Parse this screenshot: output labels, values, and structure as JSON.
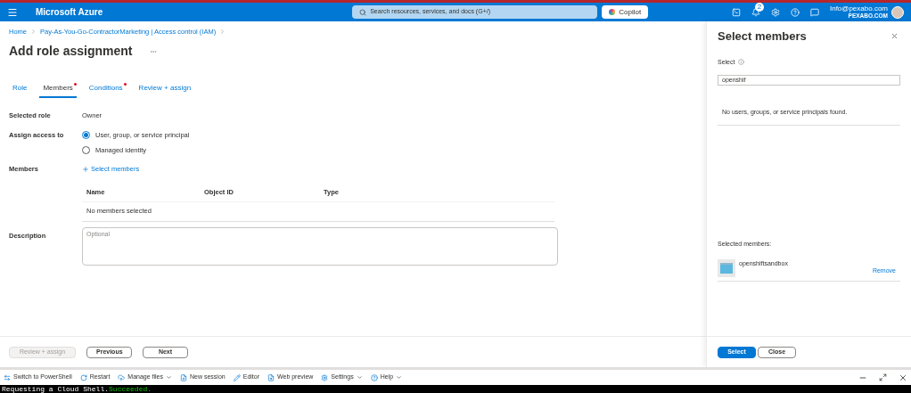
{
  "header": {
    "brand": "Microsoft Azure",
    "search": {
      "placeholder": "Search resources, services, and docs (G+/)"
    },
    "copilot": "Copilot",
    "notifications": "2",
    "account": {
      "email": "Info@pexabo.com",
      "tenant": "PEXABO.COM"
    }
  },
  "breadcrumb": [
    "Home",
    "Pay-As-You-Go-ContractorMarketing | Access control (IAM)"
  ],
  "page": {
    "title": "Add role assignment"
  },
  "tabs": [
    {
      "label": "Role",
      "selected": false,
      "required": false
    },
    {
      "label": "Members",
      "selected": true,
      "required": true
    },
    {
      "label": "Conditions",
      "selected": false,
      "required": true
    },
    {
      "label": "Review + assign",
      "selected": false,
      "required": false
    }
  ],
  "selected_role": {
    "label": "Selected role",
    "value": "Owner"
  },
  "assign_access": {
    "label": "Assign access to",
    "options": [
      {
        "label": "User, group, or service principal",
        "selected": true
      },
      {
        "label": "Managed identity",
        "selected": false
      }
    ]
  },
  "members": {
    "label": "Members",
    "add_link": "Select members",
    "table": {
      "columns": [
        "Name",
        "Object ID",
        "Type"
      ],
      "empty": "No members selected"
    }
  },
  "description": {
    "label": "Description",
    "placeholder": "Optional"
  },
  "footer_buttons": [
    {
      "label": "Review + assign",
      "disabled": true
    },
    {
      "label": "Previous",
      "disabled": false
    },
    {
      "label": "Next",
      "disabled": false
    }
  ],
  "panel": {
    "title": "Select members",
    "select_label": "Select",
    "search_value": "openshif",
    "empty_message": "No users, groups, or service principals found.",
    "selected_heading": "Selected members:",
    "selected": [
      {
        "name": "openshiftsandbox",
        "action": "Remove"
      }
    ],
    "buttons": [
      {
        "label": "Select",
        "primary": true
      },
      {
        "label": "Close",
        "primary": false
      }
    ]
  },
  "shell": {
    "toolbar": [
      {
        "label": "Switch to PowerShell",
        "dropdown": false
      },
      {
        "label": "Restart",
        "dropdown": false
      },
      {
        "label": "Manage files",
        "dropdown": true
      },
      {
        "label": "New session",
        "dropdown": false
      },
      {
        "label": "Editor",
        "dropdown": false
      },
      {
        "label": "Web preview",
        "dropdown": false
      },
      {
        "label": "Settings",
        "dropdown": true
      },
      {
        "label": "Help",
        "dropdown": true
      }
    ],
    "terminal": [
      {
        "text": "Requesting a Cloud Shell.",
        "kind": "plain"
      },
      {
        "text": "Succeeded.",
        "kind": "success"
      }
    ]
  }
}
